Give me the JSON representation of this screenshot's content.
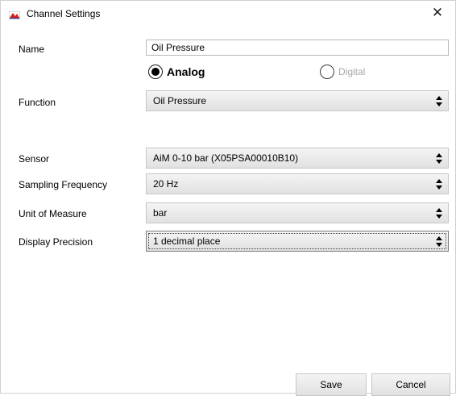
{
  "window": {
    "title": "Channel Settings",
    "app_icon": "aim-logo-icon",
    "close_glyph": "✕"
  },
  "form": {
    "name_label": "Name",
    "name_value": "Oil Pressure",
    "radio_analog": "Analog",
    "radio_digital": "Digital",
    "radio_selected": "Analog",
    "function_label": "Function",
    "function_value": "Oil Pressure",
    "sensor_label": "Sensor",
    "sensor_value": "AiM 0-10 bar (X05PSA00010B10)",
    "sampling_label": "Sampling Frequency",
    "sampling_value": "20 Hz",
    "unit_label": "Unit of Measure",
    "unit_value": "bar",
    "precision_label": "Display Precision",
    "precision_value": "1 decimal place"
  },
  "buttons": {
    "save": "Save",
    "cancel": "Cancel"
  }
}
